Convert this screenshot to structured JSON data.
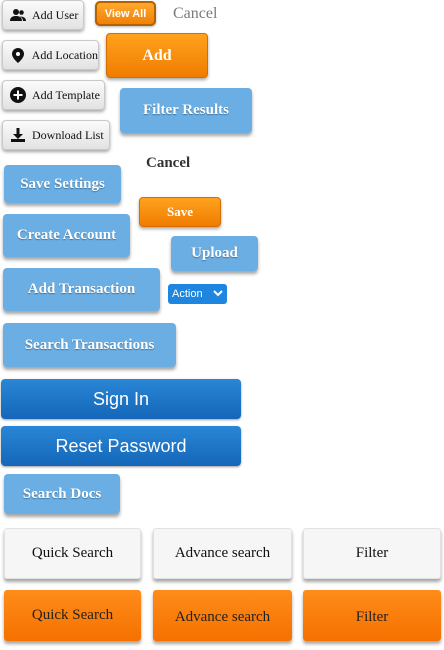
{
  "icon_buttons": [
    {
      "label": "Add User",
      "icon": "users-icon"
    },
    {
      "label": "Add Location",
      "icon": "map-pin-icon"
    },
    {
      "label": "Add Template",
      "icon": "plus-circle-icon"
    },
    {
      "label": "Download List",
      "icon": "download-icon"
    }
  ],
  "view_all": "View All",
  "cancel_top": "Cancel",
  "add": "Add",
  "filter_results": "Filter Results",
  "cancel_bold": "Cancel",
  "save_settings": "Save Settings",
  "save": "Save",
  "create_account": "Create Account",
  "upload": "Upload",
  "add_transaction": "Add Transaction",
  "action_select": {
    "selected": "Action"
  },
  "search_transactions": "Search Transactions",
  "sign_in": "Sign In",
  "reset_password": "Reset Password",
  "search_docs": "Search Docs",
  "row_plain": [
    "Quick Search",
    "Advance search",
    "Filter"
  ],
  "row_orange": [
    "Quick Search",
    "Advance search",
    "Filter"
  ],
  "colors": {
    "orange": "#f7890c",
    "light_blue": "#6aaee4",
    "dark_blue": "#1a73c6"
  }
}
